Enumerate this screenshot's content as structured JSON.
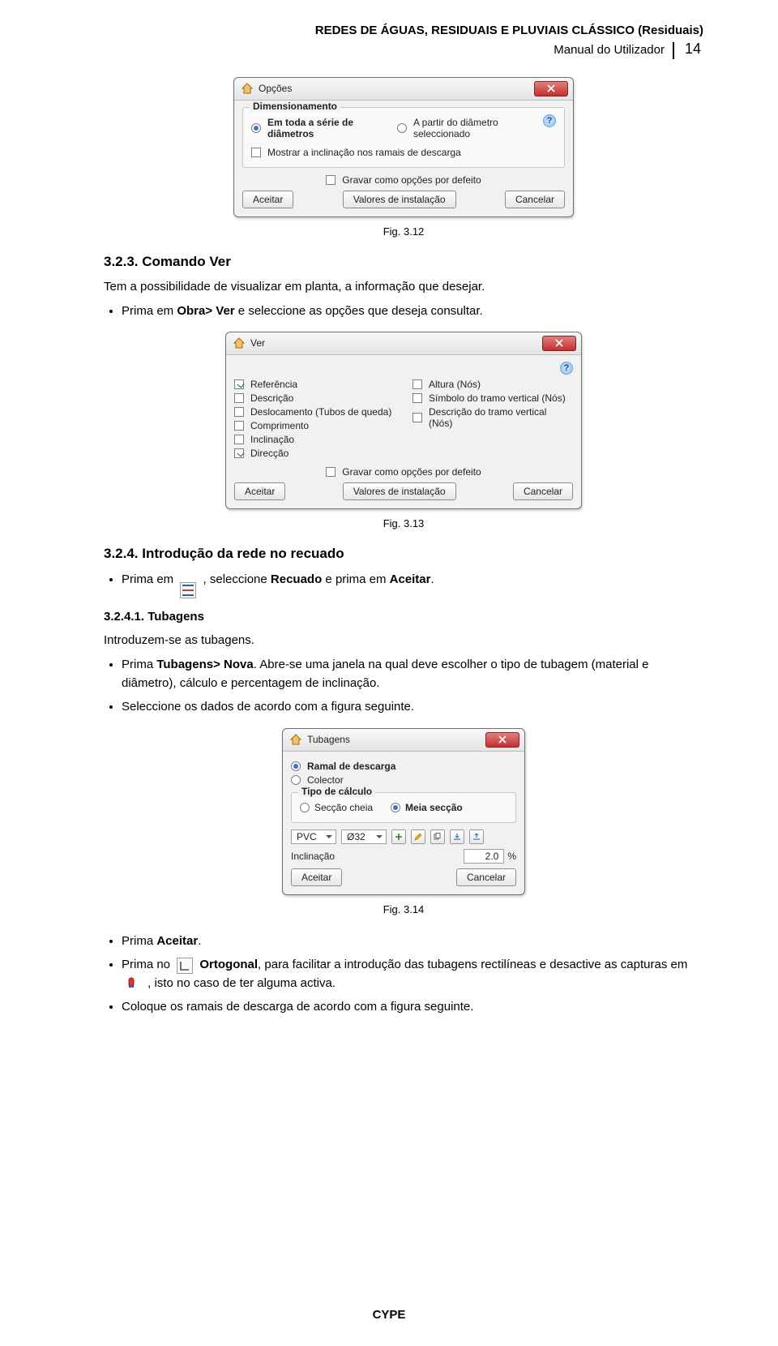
{
  "header": {
    "title": "REDES DE ÁGUAS, RESIDUAIS E PLUVIAIS CLÁSSICO (Residuais)",
    "subtitle": "Manual do Utilizador",
    "page": "14"
  },
  "dialog_opcoes": {
    "title": "Opções",
    "group_title": "Dimensionamento",
    "radio_all": "Em toda a série de diâmetros",
    "radio_from": "A partir do diâmetro seleccionado",
    "chk_show_incl": "Mostrar a inclinação nos ramais de descarga",
    "chk_save_default": "Gravar como opções por defeito",
    "btn_accept": "Aceitar",
    "btn_values": "Valores de instalação",
    "btn_cancel": "Cancelar"
  },
  "fig312": "Fig. 3.12",
  "sec323_h": "3.2.3. Comando Ver",
  "sec323_p": "Tem a possibilidade de visualizar em planta, a informação que desejar.",
  "sec323_b1_a": "Prima em ",
  "sec323_b1_b": "Obra> Ver",
  "sec323_b1_c": " e seleccione as opções que deseja consultar.",
  "dialog_ver": {
    "title": "Ver",
    "chk_ref": "Referência",
    "chk_desc": "Descrição",
    "chk_desl": "Deslocamento (Tubos de queda)",
    "chk_comp": "Comprimento",
    "chk_incl": "Inclinação",
    "chk_dir": "Direcção",
    "chk_alt": "Altura (Nós)",
    "chk_simb": "Símbolo do tramo vertical (Nós)",
    "chk_descv": "Descrição do tramo vertical (Nós)",
    "chk_save_default": "Gravar como opções por defeito",
    "btn_accept": "Aceitar",
    "btn_values": "Valores de instalação",
    "btn_cancel": "Cancelar"
  },
  "fig313": "Fig. 3.13",
  "sec324_h": "3.2.4. Introdução da rede no recuado",
  "sec324_b1_a": "Prima em ",
  "sec324_b1_b": ", seleccione ",
  "sec324_b1_c": "Recuado",
  "sec324_b1_d": " e prima em ",
  "sec324_b1_e": "Aceitar",
  "sec324_b1_f": ".",
  "sec3241_h": "3.2.4.1. Tubagens",
  "sec3241_p": "Introduzem-se as tubagens.",
  "sec3241_b1_a": "Prima ",
  "sec3241_b1_b": "Tubagens> Nova",
  "sec3241_b1_c": ". Abre-se uma janela na qual deve escolher o tipo de tubagem (material e diâmetro), cálculo e percentagem de inclinação.",
  "sec3241_b2": "Seleccione os dados de acordo com a figura seguinte.",
  "dialog_tub": {
    "title": "Tubagens",
    "r_ramal": "Ramal de descarga",
    "r_colector": "Colector",
    "group_tipo": "Tipo de cálculo",
    "r_sec_cheia": "Secção cheia",
    "r_meia_sec": "Meia secção",
    "sel_mat": "PVC",
    "sel_dia": "Ø32",
    "lbl_incl": "Inclinação",
    "val_incl": "2.0",
    "unit_incl": "%",
    "btn_accept": "Aceitar",
    "btn_cancel": "Cancelar"
  },
  "fig314": "Fig. 3.14",
  "final_b1_a": "Prima ",
  "final_b1_b": "Aceitar",
  "final_b1_c": ".",
  "final_b2_a": "Prima no ",
  "final_b2_b": " ",
  "final_b2_c": "Ortogonal",
  "final_b2_d": ", para facilitar a introdução das tubagens rectilíneas e desactive as capturas em ",
  "final_b2_e": ", isto no caso de ter alguma activa.",
  "final_b3": "Coloque os ramais de descarga de acordo com a figura seguinte.",
  "footer": "CYPE"
}
